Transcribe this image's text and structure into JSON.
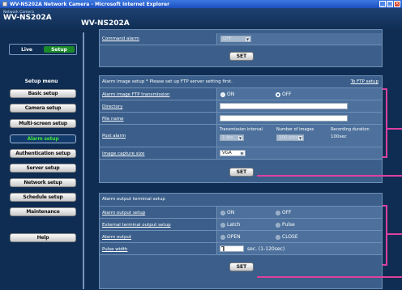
{
  "window": {
    "title": "WV-NS202A Network Camera - Microsoft Internet Explorer",
    "btn_min": "_",
    "btn_max": "□",
    "btn_close": "×"
  },
  "header": {
    "network_camera": "Network Camera",
    "model": "WV-NS202A",
    "page_title": "WV-NS202A"
  },
  "mode_tabs": {
    "live": "Live",
    "setup": "Setup"
  },
  "setup_menu": {
    "title": "Setup menu",
    "items": [
      "Basic setup",
      "Camera setup",
      "Multi-screen setup",
      "Alarm setup",
      "Authentication setup",
      "Server setup",
      "Network setup",
      "Schedule setup",
      "Maintenance"
    ],
    "active": "Alarm setup",
    "help": "Help"
  },
  "command_alarm": {
    "label": "Command alarm",
    "value": "OFF"
  },
  "set_label": "SET",
  "image_setup": {
    "header": "Alarm image setup",
    "note": "* Please set up FTP server setting first.",
    "link": "To FTP setup",
    "ftp_transmission": {
      "label": "Alarm image FTP transmission",
      "on": "ON",
      "off": "OFF"
    },
    "directory": {
      "label": "Directory",
      "value": ""
    },
    "file_name": {
      "label": "File name",
      "value": ""
    },
    "post_alarm": {
      "label": "Post alarm",
      "interval_head": "Transmission interval",
      "interval_value": "1 fps",
      "num_head": "Number of images",
      "num_value": "100 pics",
      "duration_head": "Recording duration",
      "duration_value": "100sec"
    },
    "capture_size": {
      "label": "Image capture size",
      "value": "VGA"
    }
  },
  "output_setup": {
    "header": "Alarm output terminal setup",
    "output_setup": {
      "label": "Alarm output setup",
      "on": "ON",
      "off": "OFF"
    },
    "ext_terminal": {
      "label": "External terminal output setup",
      "latch": "Latch",
      "pulse": "Pulse"
    },
    "alarm_output": {
      "label": "Alarm output",
      "open": "OPEN",
      "close": "CLOSE"
    },
    "pulse_width": {
      "label": "Pulse width",
      "value": "1",
      "unit": "sec. (1-120sec)"
    }
  }
}
